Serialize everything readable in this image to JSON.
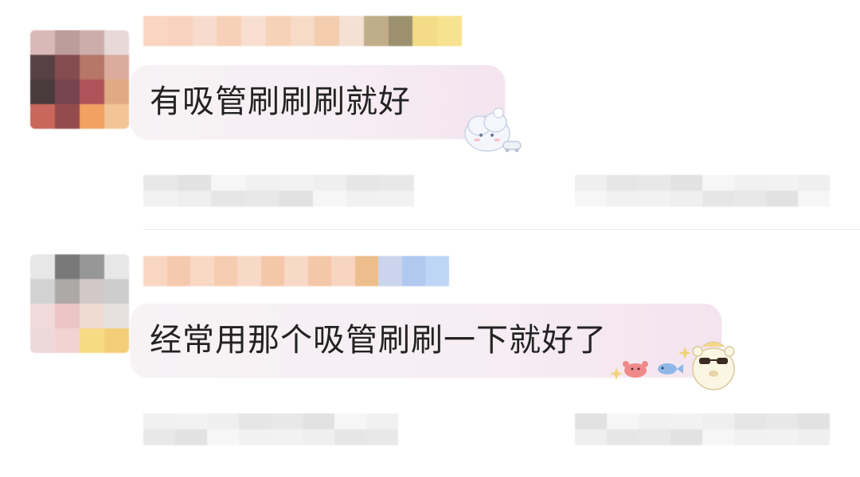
{
  "comments": [
    {
      "text": "有吸管刷刷刷就好",
      "sticker_icon": "cloud-cat-sticker-icon",
      "avatar_colors": [
        "#d9b2b3",
        "#b89591",
        "#c9a7a6",
        "#e7d6d5",
        "#4a3135",
        "#7a3d40",
        "#b06b5c",
        "#d8a596",
        "#3a2a2e",
        "#6b3440",
        "#a8454b",
        "#e0a37a",
        "#c65a4e",
        "#8c3c3e",
        "#f19a55",
        "#f2c08e"
      ],
      "username_colors": [
        "#f8c8ae",
        "#f6c3a6",
        "#f5d1bd",
        "#f4c2a0",
        "#f6d4c0",
        "#f3c39f",
        "#f5cfb6",
        "#efbd92",
        "#f2d6c6",
        "#ac9463",
        "#7d6c3e",
        "#f0cf60",
        "#f5d96a"
      ]
    },
    {
      "text": "经常用那个吸管刷刷一下就好了",
      "sticker_icon": "bear-with-sunglasses-and-crab-fish-sticker-icon",
      "avatar_colors": [
        "#e6e6e6",
        "#6e6e6e",
        "#8f8f8f",
        "#e6e6e6",
        "#cfcfcf",
        "#a7a2a2",
        "#d0c4c4",
        "#c9c9c9",
        "#f2d7d7",
        "#ebc1c1",
        "#efd8d0",
        "#e5dede",
        "#ecd6d6",
        "#f1d0cf",
        "#f6d97a",
        "#f4c96e"
      ],
      "username_colors": [
        "#f8c9ae",
        "#f4b893",
        "#f7cbb1",
        "#f3bb96",
        "#f6cdb5",
        "#f2b58d",
        "#f6ccb3",
        "#f0b58a",
        "#f5c8ad",
        "#e8a866",
        "#b9c8e8",
        "#98b6ea",
        "#a9c7f2"
      ]
    }
  ],
  "meta_colors": [
    "#d7d7d7",
    "#e9e9e9",
    "#cccccc",
    "#e3e3e3",
    "#f0f0f0",
    "#d2d2d2",
    "#e6e6e6"
  ]
}
